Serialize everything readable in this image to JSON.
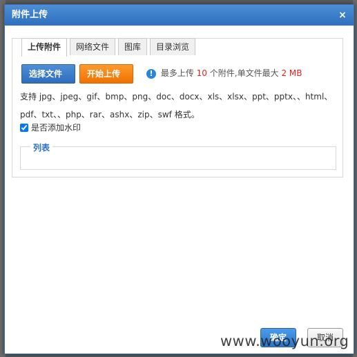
{
  "dialog": {
    "title": "附件上传",
    "close_glyph": "×"
  },
  "tabs": [
    {
      "label": "上传附件",
      "active": true
    },
    {
      "label": "网络文件",
      "active": false
    },
    {
      "label": "图库",
      "active": false
    },
    {
      "label": "目录浏览",
      "active": false
    }
  ],
  "upload": {
    "select_label": "选择文件",
    "start_label": "开始上传",
    "limit_prefix": "最多上传",
    "max_count": "10",
    "limit_mid": "个附件,单文件最大",
    "max_size": "2 MB",
    "info_icon": "!"
  },
  "formats_text": "支持 jpg、jpeg、gif、bmp、png、doc、docx、xls、xlsx、ppt、pptx、、html、pdf、txt、、php、rar、ashx、zip、swf 格式。",
  "watermark": {
    "label": "是否添加水印",
    "checked": true
  },
  "list": {
    "legend": "列表"
  },
  "footer": {
    "ok_label": "确定",
    "cancel_label": "取消"
  },
  "watermark_overlay": "www.wooyun.org",
  "colors": {
    "title_bar": "#2f6fbf",
    "select_button": "#2d6dbd",
    "start_button": "#f07100",
    "highlight": "#e02020"
  }
}
